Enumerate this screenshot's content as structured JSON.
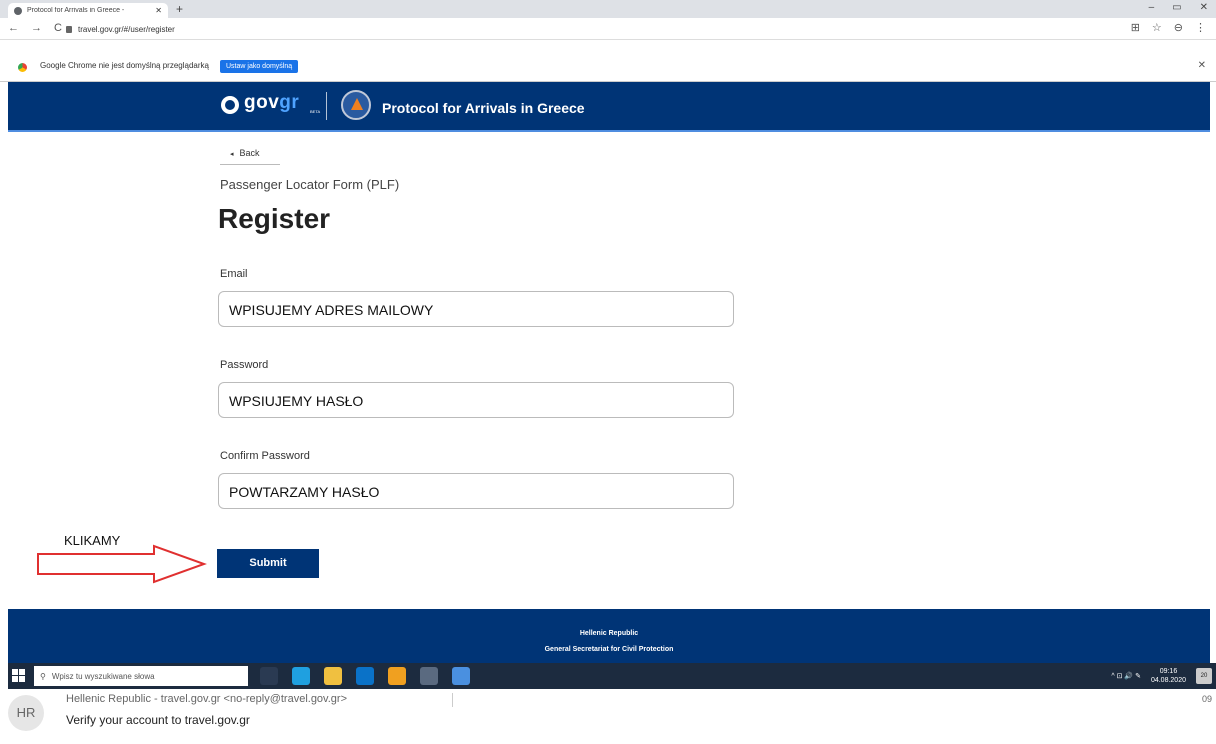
{
  "browser": {
    "tab_title": "Protocol for Arrivals in Greece - ",
    "tab_close": "✕",
    "new_tab": "+",
    "window_controls": [
      "–",
      "▭",
      "✕"
    ],
    "nav": [
      "←",
      "→",
      "C"
    ],
    "url": "travel.gov.gr/#/user/register",
    "right_icons": [
      "⊞",
      "☆",
      "⊖",
      "⋮"
    ]
  },
  "infobar": {
    "message": "Google Chrome nie jest domyślną przeglądarką",
    "button": "Ustaw jako domyślną",
    "close": "✕"
  },
  "header": {
    "logo_gov": "gov",
    "logo_gr": "gr",
    "logo_beta": "BETA",
    "site_title": "Protocol for Arrivals in Greece"
  },
  "form": {
    "back": "Back",
    "subtitle": "Passenger Locator Form (PLF)",
    "title": "Register",
    "email_label": "Email",
    "email_value": "WPISUJEMY ADRES MAILOWY",
    "password_label": "Password",
    "password_value": "WPSIUJEMY HASŁO",
    "confirm_label": "Confirm Password",
    "confirm_value": "POWTARZAMY HASŁO",
    "submit": "Submit"
  },
  "annotation": {
    "text": "KLIKAMY",
    "arrow_color": "#e03030"
  },
  "footer": {
    "line1": "Hellenic Republic",
    "line2": "General Secretariat for Civil Protection"
  },
  "taskbar": {
    "search_placeholder": "Wpisz tu wyszukiwane słowa",
    "tray_icons": "^ ⊡ 🔊 ✎",
    "time": "09:16",
    "date": "04.08.2020",
    "notifications": "20"
  },
  "email": {
    "avatar": "HR",
    "sender": "Hellenic Republic - travel.gov.gr <no-reply@travel.gov.gr>",
    "subject": "Verify your account to travel.gov.gr",
    "time": "09"
  },
  "colors": {
    "brand_navy": "#003476",
    "accent_blue": "#4f8de0"
  }
}
